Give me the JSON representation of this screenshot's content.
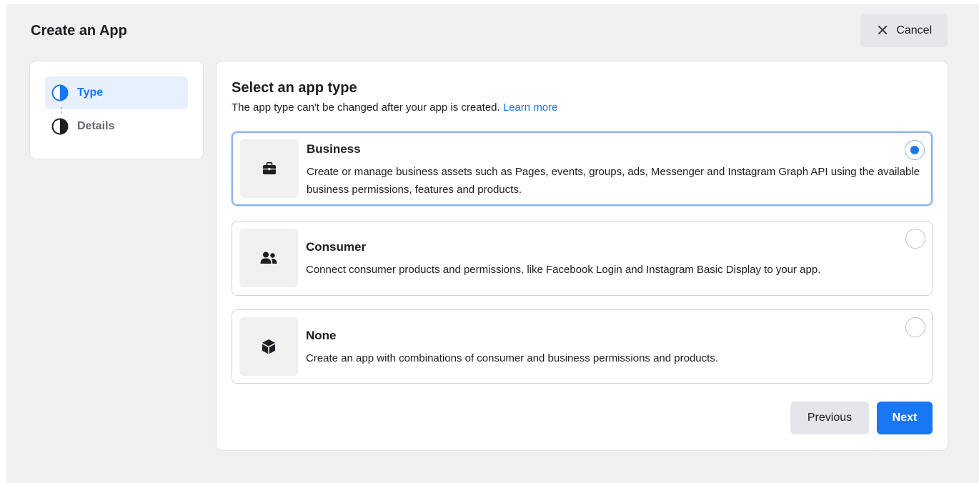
{
  "header": {
    "title": "Create an App",
    "cancel_label": "Cancel",
    "cancel_icon": "close-icon"
  },
  "steps": [
    {
      "label": "Type",
      "state": "active",
      "icon": "half-circle-icon"
    },
    {
      "label": "Details",
      "state": "inactive",
      "icon": "half-circle-icon"
    }
  ],
  "main": {
    "title": "Select an app type",
    "subtitle": "The app type can't be changed after your app is created.",
    "learn_more": "Learn more",
    "options": [
      {
        "title": "Business",
        "description": "Create or manage business assets such as Pages, events, groups, ads, Messenger and Instagram Graph API using the available business permissions, features and products.",
        "icon": "briefcase-icon",
        "selected": true
      },
      {
        "title": "Consumer",
        "description": "Connect consumer products and permissions, like Facebook Login and Instagram Basic Display to your app.",
        "icon": "people-icon",
        "selected": false
      },
      {
        "title": "None",
        "description": "Create an app with combinations of consumer and business permissions and products.",
        "icon": "cube-icon",
        "selected": false
      }
    ],
    "previous_label": "Previous",
    "next_label": "Next"
  },
  "colors": {
    "accent": "#1877f2",
    "background": "#f0f0f0",
    "selected_border": "#8db4ef"
  }
}
